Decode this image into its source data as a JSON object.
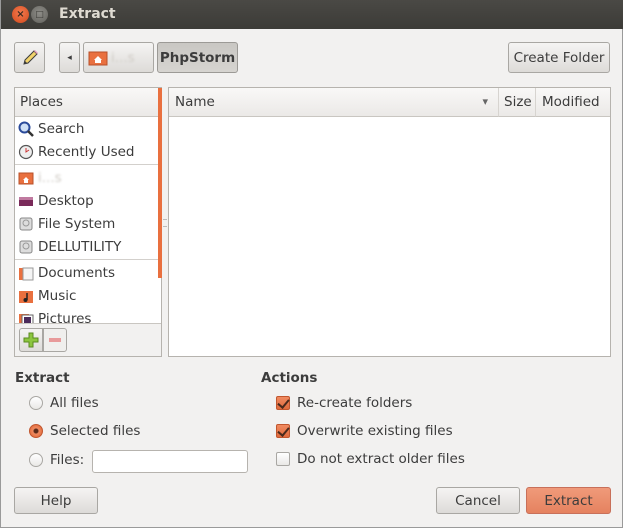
{
  "window": {
    "title": "Extract",
    "close_glyph": "×",
    "minimize_glyph": "□"
  },
  "toolbar": {
    "edit_icon": "pencil-icon",
    "back_glyph": "◂",
    "path": [
      {
        "label": "i...s",
        "icon": "home-folder-icon",
        "obscured": true
      },
      {
        "label": "PhpStorm",
        "active": true
      }
    ],
    "create_folder_label": "Create Folder"
  },
  "places": {
    "header": "Places",
    "groups": [
      [
        {
          "label": "Search",
          "icon": "search-icon"
        },
        {
          "label": "Recently Used",
          "icon": "recent-icon"
        }
      ],
      [
        {
          "label": "i...s",
          "icon": "home-folder-icon",
          "obscured": true
        },
        {
          "label": "Desktop",
          "icon": "desktop-icon"
        },
        {
          "label": "File System",
          "icon": "drive-icon"
        },
        {
          "label": "DELLUTILITY",
          "icon": "drive-icon"
        }
      ],
      [
        {
          "label": "Documents",
          "icon": "documents-folder-icon"
        },
        {
          "label": "Music",
          "icon": "music-folder-icon"
        },
        {
          "label": "Pictures",
          "icon": "pictures-folder-icon"
        }
      ]
    ],
    "add_glyph": "+",
    "remove_glyph": "−"
  },
  "files": {
    "columns": [
      {
        "label": "Name",
        "sort_glyph": "▾"
      },
      {
        "label": "Size"
      },
      {
        "label": "Modified"
      }
    ],
    "rows": []
  },
  "extract": {
    "title": "Extract",
    "options": [
      {
        "label": "All files",
        "selected": false
      },
      {
        "label": "Selected files",
        "selected": true
      },
      {
        "label": "Files:",
        "selected": false
      }
    ],
    "files_value": "",
    "files_placeholder": ""
  },
  "actions": {
    "title": "Actions",
    "options": [
      {
        "label": "Re-create folders",
        "checked": true
      },
      {
        "label": "Overwrite existing files",
        "checked": true
      },
      {
        "label": "Do not extract older files",
        "checked": false
      }
    ]
  },
  "buttons": {
    "help": "Help",
    "cancel": "Cancel",
    "extract": "Extract"
  },
  "colors": {
    "accent": "#e9703f",
    "titlebar": "#3c3b37",
    "background": "#f2f1f0"
  }
}
